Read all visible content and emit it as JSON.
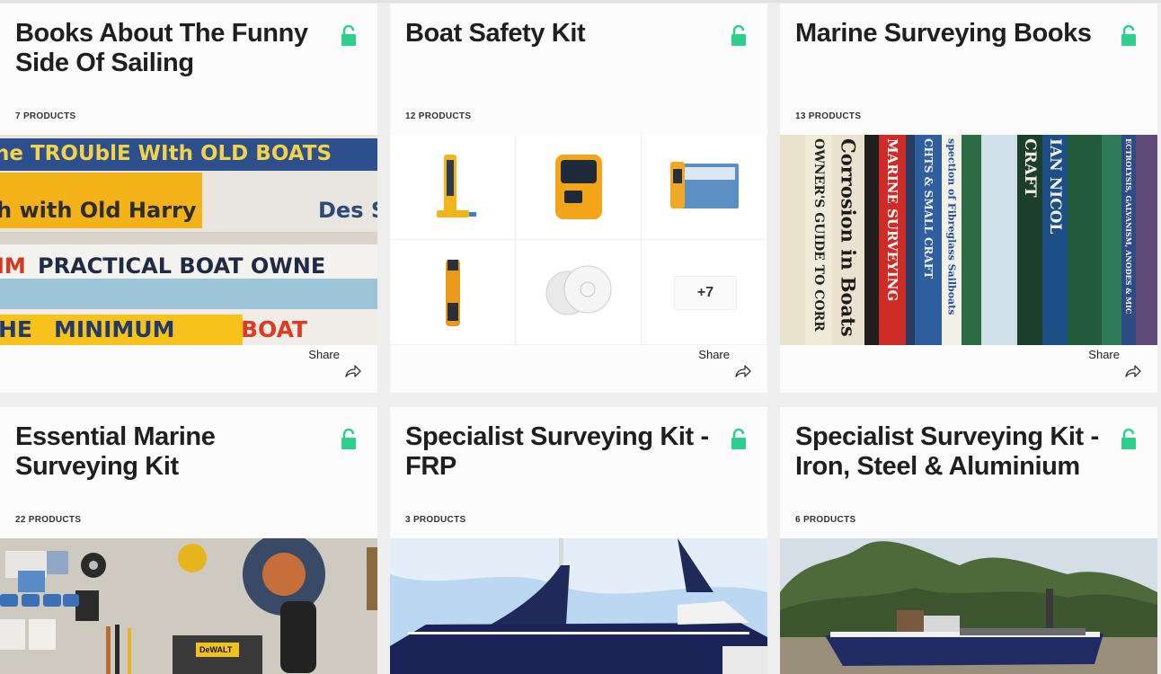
{
  "colors": {
    "lock": "#2ecf8d",
    "background": "#eeeeef"
  },
  "share_label": "Share",
  "collections": [
    {
      "title": "Books About The Funny Side Of Sailing",
      "count": "7 PRODUCTS",
      "spines": [
        "he TROUblE WIth OLD BOATS",
        "h with Old Harry",
        "Des S",
        "IM",
        "PRACTICAL BOAT OWNE",
        "HE",
        "MINIMUM",
        "BOAT"
      ]
    },
    {
      "title": "Boat Safety Kit",
      "count": "12 PRODUCTS",
      "more": "+7"
    },
    {
      "title": "Marine Surveying Books",
      "count": "13 PRODUCTS",
      "spines": [
        "Corrosion in Boats",
        "OWNER'S GUIDE TO CORR",
        "MARINE SURVEYING",
        "CHTS & SMALL CRAFT",
        "spection of Fibreglass Sailboats",
        "CRAFT",
        "IAN NICOL",
        "ECTROLYSIS, GALVANISM, ANODES & MIC"
      ]
    },
    {
      "title": "Essential Marine Surveying Kit",
      "count": "22 PRODUCTS",
      "tool_label": "DeWALT"
    },
    {
      "title": "Specialist Surveying Kit - FRP",
      "count": "3 PRODUCTS"
    },
    {
      "title": "Specialist Surveying Kit - Iron, Steel & Aluminium",
      "count": "6 PRODUCTS"
    }
  ]
}
